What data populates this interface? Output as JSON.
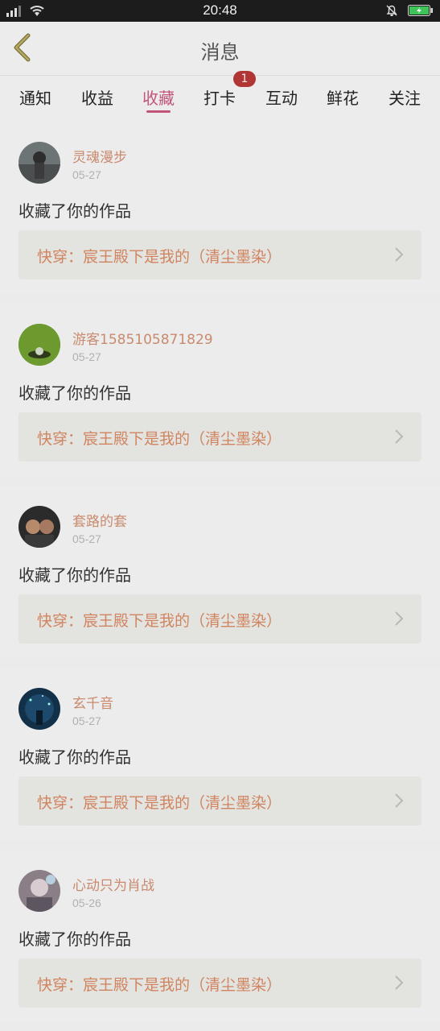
{
  "status_bar": {
    "time": "20:48"
  },
  "header": {
    "title": "消息"
  },
  "tabs": [
    {
      "label": "通知"
    },
    {
      "label": "收益"
    },
    {
      "label": "收藏",
      "active": true
    },
    {
      "label": "打卡",
      "badge": "1"
    },
    {
      "label": "互动"
    },
    {
      "label": "鲜花"
    },
    {
      "label": "关注"
    }
  ],
  "messages": [
    {
      "username": "灵魂漫步",
      "date": "05-27",
      "action": "收藏了你的作品",
      "work_title": "快穿：宸王殿下是我的（清尘墨染）"
    },
    {
      "username": "游客1585105871829",
      "date": "05-27",
      "action": "收藏了你的作品",
      "work_title": "快穿：宸王殿下是我的（清尘墨染）"
    },
    {
      "username": "套路的套",
      "date": "05-27",
      "action": "收藏了你的作品",
      "work_title": "快穿：宸王殿下是我的（清尘墨染）"
    },
    {
      "username": "玄千音",
      "date": "05-27",
      "action": "收藏了你的作品",
      "work_title": "快穿：宸王殿下是我的（清尘墨染）"
    },
    {
      "username": "心动只为肖战",
      "date": "05-26",
      "action": "收藏了你的作品",
      "work_title": "快穿：宸王殿下是我的（清尘墨染）"
    }
  ],
  "colors": {
    "accent": "#c2557a",
    "username": "#c98a6e",
    "work_title": "#d0845f",
    "badge": "#b23535"
  }
}
